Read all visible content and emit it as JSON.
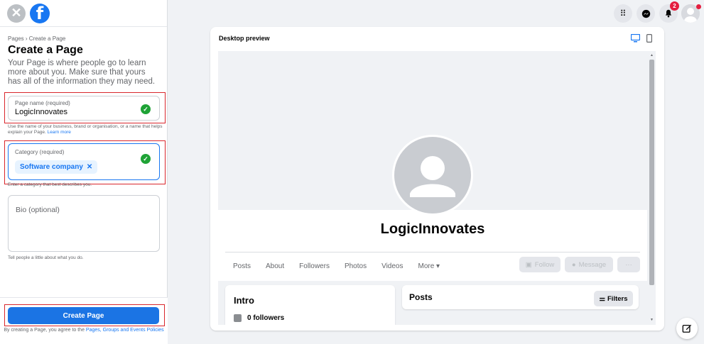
{
  "breadcrumb": "Pages › Create a Page",
  "title": "Create a Page",
  "description": "Your Page is where people go to learn more about you. Make sure that yours has all of the information they may need.",
  "page_name": {
    "label": "Page name (required)",
    "value": "LogicInnovates",
    "help_text": "Use the name of your business, brand or organisation, or a name that helps explain your Page.",
    "help_link": "Learn more"
  },
  "category": {
    "label": "Category (required)",
    "chip": "Software company",
    "help_text": "Enter a category that best describes you."
  },
  "bio": {
    "placeholder": "Bio (optional)",
    "help_text": "Tell people a little about what you do."
  },
  "footer": {
    "create_button": "Create Page",
    "policy_prefix": "By creating a Page, you agree to the",
    "policy_link": "Pages, Groups and Events Policies"
  },
  "header": {
    "notifications_count": "2"
  },
  "preview": {
    "heading": "Desktop preview",
    "page_name": "LogicInnovates",
    "tabs": [
      "Posts",
      "About",
      "Followers",
      "Photos",
      "Videos",
      "More ▾"
    ],
    "follow_button": "Follow",
    "message_button": "Message",
    "more_button": "···",
    "intro_title": "Intro",
    "followers_text": "0 followers",
    "posts_title": "Posts",
    "filters_button": "Filters"
  },
  "colors": {
    "brand": "#1877f2",
    "highlight": "#d9262c",
    "success": "#1fa336"
  }
}
